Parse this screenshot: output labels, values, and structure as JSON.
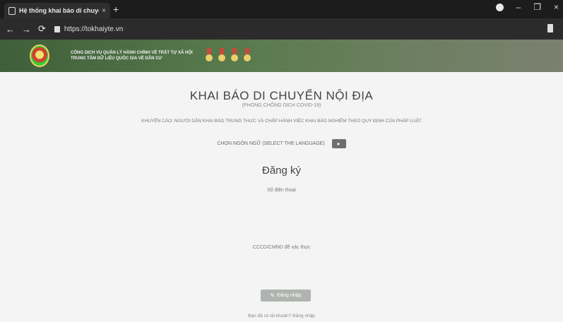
{
  "browser": {
    "tab_title": "Hệ thống khai báo di chuyển nội",
    "tab_close": "×",
    "new_tab": "+",
    "url": "https://tokhaiyte.vn",
    "window_controls": {
      "minimize": "–",
      "restore": "❐",
      "close": "×"
    },
    "nav": {
      "back": "←",
      "forward": "→",
      "reload": "⟳"
    }
  },
  "banner": {
    "org_line1": "CỔNG DỊCH VỤ QUẢN LÝ HÀNH CHÍNH VỀ TRẬT TỰ XÃ HỘI",
    "org_line2": "TRUNG TÂM DỮ LIỆU QUỐC GIA VỀ DÂN CƯ"
  },
  "main": {
    "title": "KHAI BÁO DI CHUYỂN NỘI ĐỊA",
    "subtitle": "(PHÒNG CHỐNG DỊCH COVID-19)",
    "notice": "KHUYẾN CÁO: NGƯỜI DÂN KHAI BÁO TRUNG THỰC VÀ CHẤP HÀNH VIỆC KHAI BÁO NGHIÊM THEO QUY ĐỊNH CỦA PHÁP LUẬT",
    "language_label": "CHỌN NGÔN NGỮ (SELECT THE LANGUAGE)",
    "language_button": "▸",
    "section_title": "Đăng ký",
    "phone_label": "Số điện thoại",
    "id_label": "CCCD/CMND để xác thực",
    "register_button": "Đăng nhập",
    "footer_link": "Bạn đã có tài khoản? Đăng nhập"
  }
}
